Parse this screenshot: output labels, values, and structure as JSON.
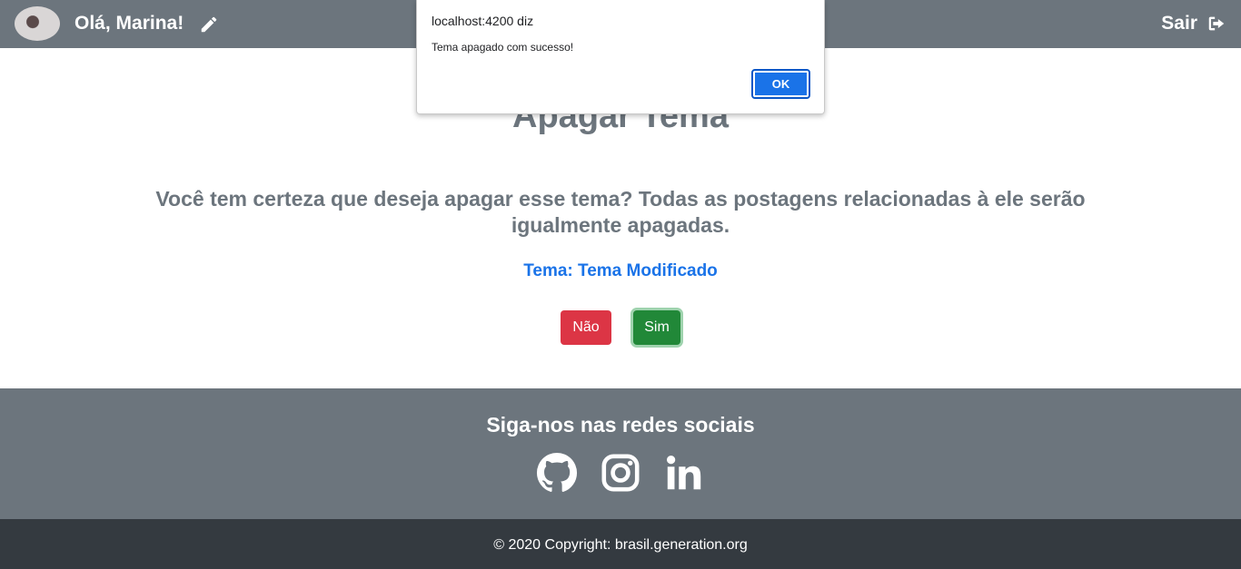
{
  "navbar": {
    "greeting": "Olá, Marina!",
    "logout_label": "Sair",
    "background": "#6c757d"
  },
  "main": {
    "title": "Apagar Tema",
    "question": "Você tem certeza que deseja apagar esse tema? Todas as postagens relacionadas à ele serão igualmente apagadas.",
    "theme_label": "Tema: Tema Modificado",
    "no_button": "Não",
    "yes_button": "Sim"
  },
  "social": {
    "title": "Siga-nos nas redes sociais",
    "icons": [
      "github-icon",
      "instagram-icon",
      "linkedin-icon"
    ]
  },
  "footer": {
    "text": "© 2020 Copyright: brasil.generation.org",
    "background": "#343a40"
  },
  "alert_dialog": {
    "title": "localhost:4200 diz",
    "message": "Tema apagado com sucesso!",
    "ok_label": "OK"
  },
  "colors": {
    "danger": "#dc3545",
    "success": "#218838",
    "link": "#1a73e8"
  }
}
